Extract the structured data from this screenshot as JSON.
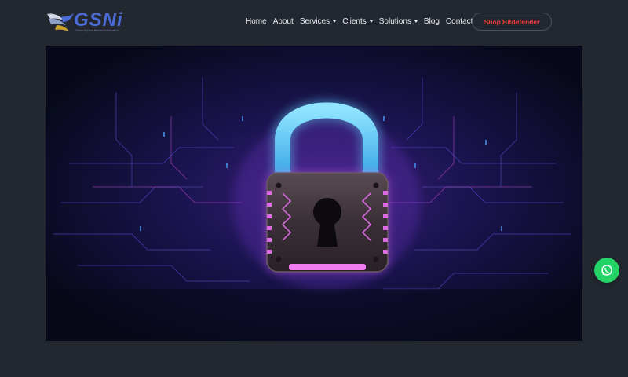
{
  "header": {
    "logo_text": "GSNi",
    "logo_tagline": "Global System Network Information"
  },
  "nav": {
    "items": [
      {
        "label": "Home",
        "has_dropdown": false
      },
      {
        "label": "About",
        "has_dropdown": false
      },
      {
        "label": "Services",
        "has_dropdown": true
      },
      {
        "label": "Clients",
        "has_dropdown": true
      },
      {
        "label": "Solutions",
        "has_dropdown": true
      },
      {
        "label": "Blog",
        "has_dropdown": false
      },
      {
        "label": "Contact",
        "has_dropdown": false
      }
    ],
    "cta_label": "Shop Bitdefender"
  },
  "hero": {
    "image_subject": "padlock-on-circuit-board",
    "icon": "padlock-icon"
  },
  "floating": {
    "whatsapp_icon": "whatsapp-icon"
  },
  "colors": {
    "background": "#232830",
    "logo_blue": "#4b6bd6",
    "cta_text": "#ef3b3b",
    "shackle": "#5ec8f5",
    "glow_pink": "#e06be8",
    "whatsapp_green": "#24d366"
  }
}
